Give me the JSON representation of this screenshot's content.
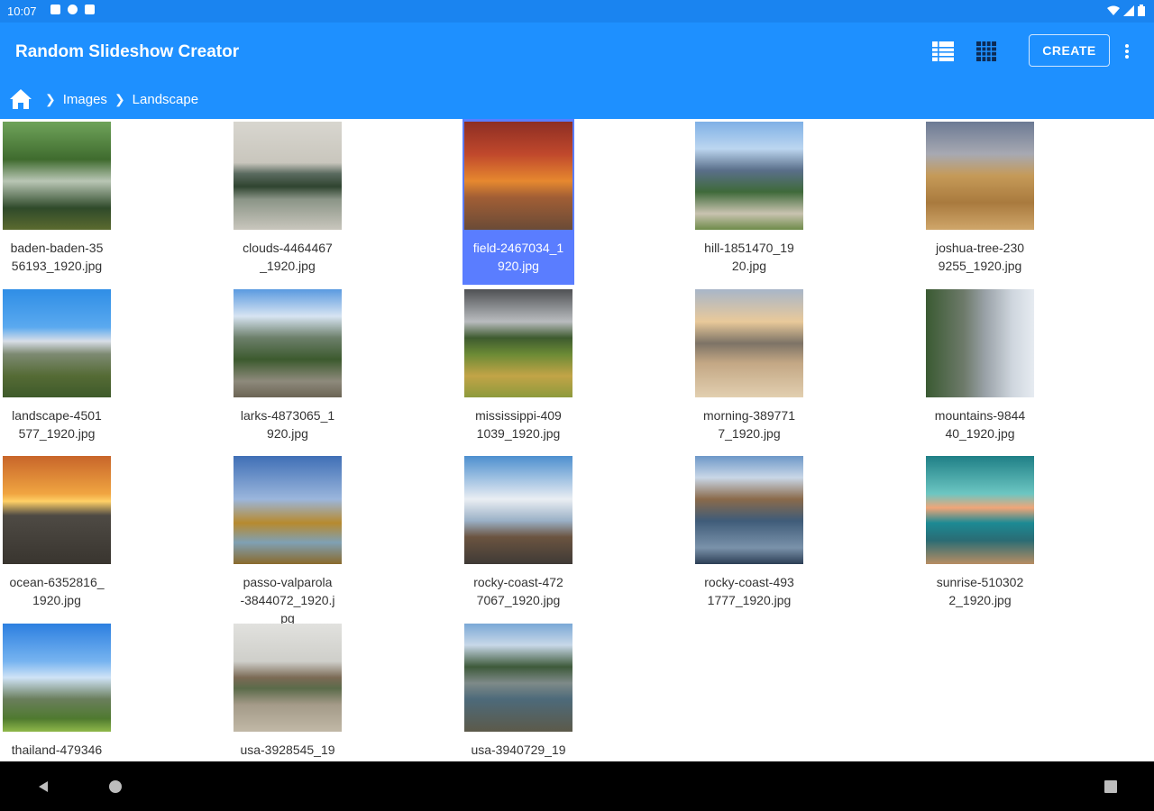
{
  "statusbar": {
    "time": "10:07"
  },
  "appbar": {
    "title": "Random Slideshow Creator",
    "create_label": "CREATE",
    "breadcrumb": {
      "items": [
        "Images",
        "Landscape"
      ]
    }
  },
  "files": [
    {
      "name": "baden-baden-3556193_1920.jpg",
      "line1": "baden-baden-35",
      "line2": "56193_1920.jpg",
      "line3": "",
      "selected": false
    },
    {
      "name": "clouds-4464467_1920.jpg",
      "line1": "clouds-4464467",
      "line2": "_1920.jpg",
      "line3": "",
      "selected": false
    },
    {
      "name": "field-2467034_1920.jpg",
      "line1": "field-2467034_1",
      "line2": "920.jpg",
      "line3": "",
      "selected": true
    },
    {
      "name": "hill-1851470_1920.jpg",
      "line1": "hill-1851470_19",
      "line2": "20.jpg",
      "line3": "",
      "selected": false
    },
    {
      "name": "joshua-tree-2309255_1920.jpg",
      "line1": "joshua-tree-230",
      "line2": "9255_1920.jpg",
      "line3": "",
      "selected": false
    },
    {
      "name": "landscape-4501577_1920.jpg",
      "line1": "landscape-4501",
      "line2": "577_1920.jpg",
      "line3": "",
      "selected": false
    },
    {
      "name": "larks-4873065_1920.jpg",
      "line1": "larks-4873065_1",
      "line2": "920.jpg",
      "line3": "",
      "selected": false
    },
    {
      "name": "mississippi-4091039_1920.jpg",
      "line1": "mississippi-409",
      "line2": "1039_1920.jpg",
      "line3": "",
      "selected": false
    },
    {
      "name": "morning-3897717_1920.jpg",
      "line1": "morning-389771",
      "line2": "7_1920.jpg",
      "line3": "",
      "selected": false
    },
    {
      "name": "mountains-984440_1920.jpg",
      "line1": "mountains-9844",
      "line2": "40_1920.jpg",
      "line3": "",
      "selected": false
    },
    {
      "name": "ocean-6352816_1920.jpg",
      "line1": "ocean-6352816_",
      "line2": "1920.jpg",
      "line3": "",
      "selected": false
    },
    {
      "name": "passo-valparola-3844072_1920.jpg",
      "line1": "passo-valparola",
      "line2": "-3844072_1920.j",
      "line3": "pg",
      "selected": false
    },
    {
      "name": "rocky-coast-4727067_1920.jpg",
      "line1": "rocky-coast-472",
      "line2": "7067_1920.jpg",
      "line3": "",
      "selected": false
    },
    {
      "name": "rocky-coast-4931777_1920.jpg",
      "line1": "rocky-coast-493",
      "line2": "1777_1920.jpg",
      "line3": "",
      "selected": false
    },
    {
      "name": "sunrise-5103022_1920.jpg",
      "line1": "sunrise-510302",
      "line2": "2_1920.jpg",
      "line3": "",
      "selected": false
    },
    {
      "name": "thailand-479346",
      "line1": "thailand-479346",
      "line2": "",
      "line3": "",
      "selected": false
    },
    {
      "name": "usa-3928545_19",
      "line1": "usa-3928545_19",
      "line2": "",
      "line3": "",
      "selected": false
    },
    {
      "name": "usa-3940729_19",
      "line1": "usa-3940729_19",
      "line2": "",
      "line3": "",
      "selected": false
    }
  ]
}
